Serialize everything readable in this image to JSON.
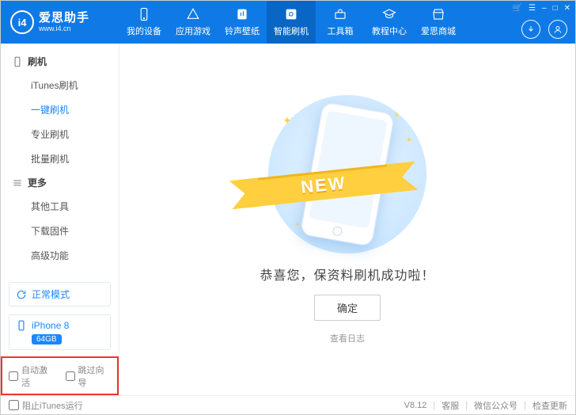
{
  "app": {
    "name": "爱思助手",
    "url": "www.i4.cn",
    "logo_letters": "i4"
  },
  "winctl": {
    "cart": "🛒",
    "menu": "☰",
    "min": "–",
    "max": "□",
    "close": "✕"
  },
  "nav": [
    {
      "key": "device",
      "label": "我的设备"
    },
    {
      "key": "apps",
      "label": "应用游戏"
    },
    {
      "key": "ring",
      "label": "铃声壁纸"
    },
    {
      "key": "flash",
      "label": "智能刷机",
      "active": true
    },
    {
      "key": "tools",
      "label": "工具箱"
    },
    {
      "key": "tutorial",
      "label": "教程中心"
    },
    {
      "key": "mall",
      "label": "爱思商城"
    }
  ],
  "sidebar": {
    "group1": {
      "title": "刷机",
      "items": [
        {
          "key": "itunes",
          "label": "iTunes刷机"
        },
        {
          "key": "onekey",
          "label": "一键刷机",
          "active": true
        },
        {
          "key": "pro",
          "label": "专业刷机"
        },
        {
          "key": "batch",
          "label": "批量刷机"
        }
      ]
    },
    "group2": {
      "title": "更多",
      "items": [
        {
          "key": "other",
          "label": "其他工具"
        },
        {
          "key": "fw",
          "label": "下载固件"
        },
        {
          "key": "adv",
          "label": "高级功能"
        }
      ]
    },
    "mode": "正常模式",
    "device": {
      "name": "iPhone 8",
      "storage": "64GB"
    },
    "opts": {
      "auto_activate": "自动激活",
      "skip_guide": "跳过向导"
    }
  },
  "main": {
    "ribbon": "NEW",
    "message": "恭喜您，保资料刷机成功啦！",
    "ok": "确定",
    "log": "查看日志"
  },
  "footer": {
    "block_itunes": "阻止iTunes运行",
    "version": "V8.12",
    "service": "客服",
    "wechat": "微信公众号",
    "update": "检查更新"
  }
}
